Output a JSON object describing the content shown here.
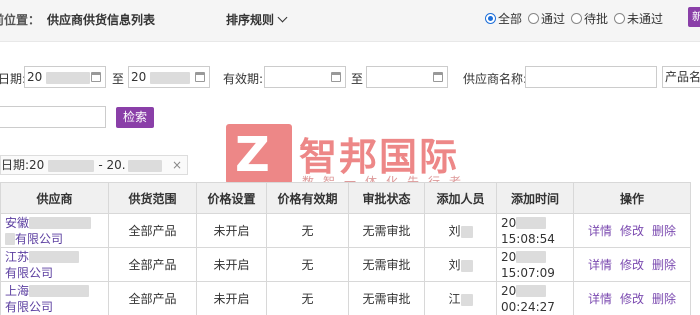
{
  "header": {
    "location_prefix": "当前位置：",
    "location_title": "供应商供货信息列表",
    "sort_label": "排序规则",
    "filters": [
      {
        "label": "全部",
        "checked": true
      },
      {
        "label": "通过",
        "checked": false
      },
      {
        "label": "待批",
        "checked": false
      },
      {
        "label": "未通过",
        "checked": false
      }
    ],
    "corner_button": "新"
  },
  "search": {
    "date_label": "日期:",
    "date_start": "20",
    "to1": "至",
    "date_end": "20",
    "valid_label": "有效期:",
    "to2": "至",
    "supplier_label": "供应商名称:",
    "product_label": "产品名",
    "search_button": "检索"
  },
  "active_filter": {
    "text_prefix": "日期:20",
    "text_middle": "- 20.",
    "close": "×"
  },
  "watermark": {
    "logo_letter": "Z",
    "name": "智邦国际",
    "slogan": "数智一体化先行者"
  },
  "table": {
    "columns": [
      "供应商",
      "供货范围",
      "价格设置",
      "价格有效期",
      "审批状态",
      "添加人员",
      "添加时间",
      "操作"
    ],
    "rows": [
      {
        "supplier_line1": "安徽",
        "supplier_line2": "有限公司",
        "scope": "全部产品",
        "price": "未开启",
        "validity": "无",
        "approval": "无需审批",
        "user": "刘",
        "date": "20",
        "time": "15:08:54"
      },
      {
        "supplier_line1": "江苏",
        "supplier_line2": "有限公司",
        "scope": "全部产品",
        "price": "未开启",
        "validity": "无",
        "approval": "无需审批",
        "user": "刘",
        "date": "20",
        "time": "15:07:09"
      },
      {
        "supplier_line1": "上海",
        "supplier_line2": "有限公司",
        "scope": "全部产品",
        "price": "未开启",
        "validity": "无",
        "approval": "无需审批",
        "user": "江",
        "date": "20",
        "time": "00:24:27"
      }
    ],
    "actions": {
      "detail": "详情",
      "edit": "修改",
      "delete": "删除"
    }
  }
}
